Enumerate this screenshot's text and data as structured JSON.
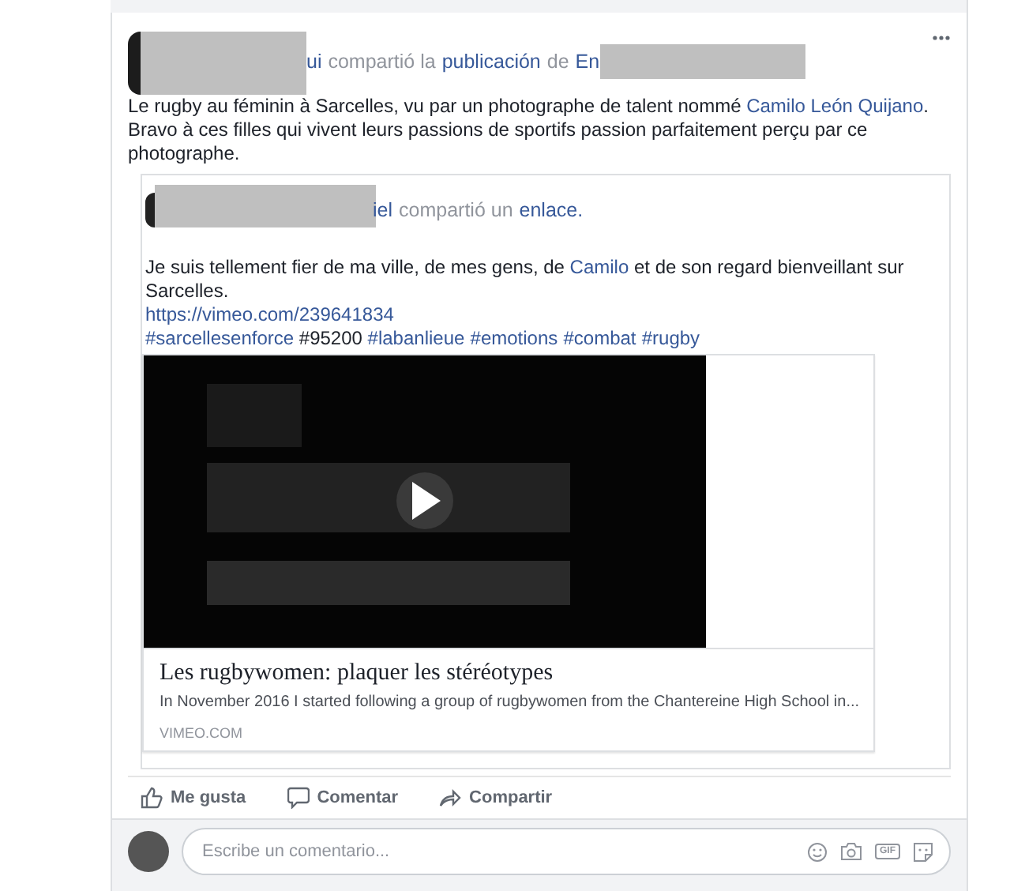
{
  "post": {
    "author_fragment": "ui",
    "action_words": [
      {
        "text": "compartió la",
        "kind": "plain"
      },
      {
        "text": "publicación",
        "kind": "link"
      },
      {
        "text": "de",
        "kind": "plain"
      },
      {
        "text": "En",
        "kind": "link"
      }
    ],
    "body": [
      {
        "text": "Le rugby au féminin à Sarcelles, vu par un photographe de talent nommé ",
        "link": false
      },
      {
        "text": "Camilo León Quijano",
        "link": true
      },
      {
        "text": ". Bravo à ces filles qui vivent leurs passions de sportifs passion parfaitement perçu par ce photographe.",
        "link": false
      }
    ]
  },
  "shared": {
    "author_fragment": "iel",
    "action_words": [
      {
        "text": "compartió un",
        "kind": "plain"
      },
      {
        "text": "enlace.",
        "kind": "link"
      }
    ],
    "body_lines": [
      [
        {
          "text": "Je suis tellement fier de ma ville, de mes gens, de ",
          "link": false
        },
        {
          "text": "Camilo",
          "link": true
        },
        {
          "text": " et de son regard bienveillant sur Sarcelles.",
          "link": false
        }
      ],
      [
        {
          "text": "https://vimeo.com/239641834",
          "link": true
        }
      ],
      [
        {
          "text": "#sarcellesenforce",
          "link": true
        },
        {
          "text": " #95200 ",
          "link": false
        },
        {
          "text": "#labanlieue",
          "link": true
        },
        {
          "text": "#emotions",
          "link": true
        },
        {
          "text": "#combat",
          "link": true
        },
        {
          "text": "#rugby",
          "link": true
        }
      ]
    ],
    "link": {
      "title": "Les rugbywomen: plaquer les stéréotypes",
      "description": "In November 2016 I started following a group of rugbywomen from the Chantereine High School in...",
      "domain": "VIMEO.COM"
    }
  },
  "actions": [
    {
      "label": "Me gusta",
      "kind": "like"
    },
    {
      "label": "Comentar",
      "kind": "comment"
    },
    {
      "label": "Compartir",
      "kind": "share"
    }
  ],
  "comment_box": {
    "placeholder": "Escribe un comentario...",
    "gif_label": "GIF"
  }
}
